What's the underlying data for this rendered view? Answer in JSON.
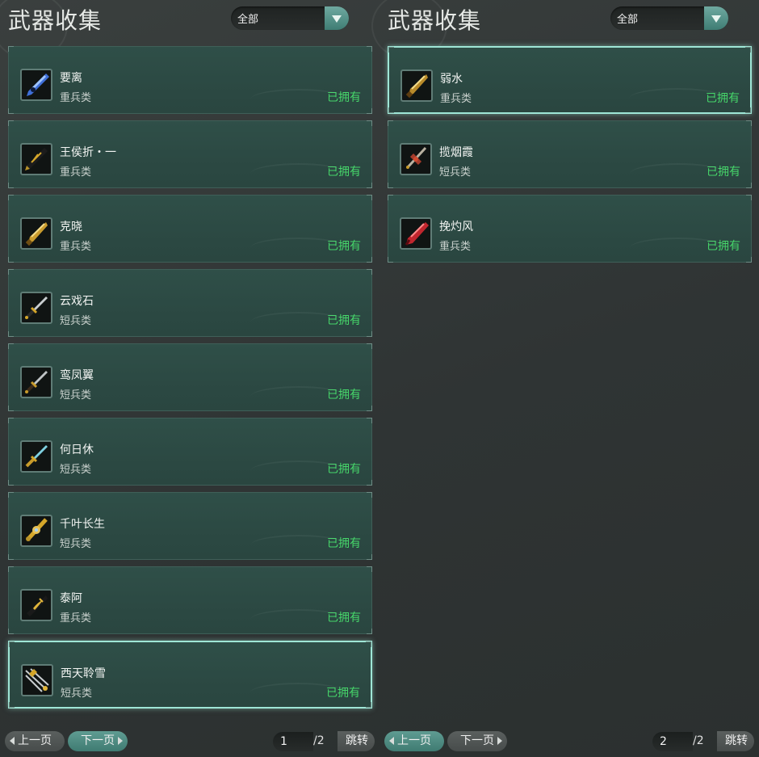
{
  "panels": [
    {
      "title": "武器收集",
      "filter": {
        "selected": "全部"
      },
      "items": [
        {
          "name": "要离",
          "category": "重兵类",
          "status": "已拥有",
          "icon": "blue-crystal-blade-icon"
        },
        {
          "name": "王侯折・一",
          "category": "重兵类",
          "status": "已拥有",
          "icon": "black-gold-sword-icon"
        },
        {
          "name": "克晓",
          "category": "重兵类",
          "status": "已拥有",
          "icon": "golden-blade-icon"
        },
        {
          "name": "云戏石",
          "category": "短兵类",
          "status": "已拥有",
          "icon": "dagger-icon"
        },
        {
          "name": "鸾凤翼",
          "category": "短兵类",
          "status": "已拥有",
          "icon": "dagger-icon"
        },
        {
          "name": "何日休",
          "category": "短兵类",
          "status": "已拥有",
          "icon": "jade-dagger-icon"
        },
        {
          "name": "千叶长生",
          "category": "短兵类",
          "status": "已拥有",
          "icon": "ornate-dagger-icon"
        },
        {
          "name": "泰阿",
          "category": "重兵类",
          "status": "已拥有",
          "icon": "black-gold-sword-icon"
        },
        {
          "name": "西天聆雪",
          "category": "短兵类",
          "status": "已拥有",
          "icon": "trident-dagger-icon"
        }
      ],
      "pagination": {
        "prev": "上一页",
        "next": "下一页",
        "page": "1",
        "total": "/2",
        "jump": "跳转"
      }
    },
    {
      "title": "武器收集",
      "filter": {
        "selected": "全部"
      },
      "items": [
        {
          "name": "弱水",
          "category": "重兵类",
          "status": "已拥有",
          "icon": "golden-blade-icon"
        },
        {
          "name": "揽烟霞",
          "category": "短兵类",
          "status": "已拥有",
          "icon": "red-ornate-dagger-icon"
        },
        {
          "name": "挽灼风",
          "category": "重兵类",
          "status": "已拥有",
          "icon": "red-crystal-blade-icon"
        }
      ],
      "pagination": {
        "prev": "上一页",
        "next": "下一页",
        "page": "2",
        "total": "/2",
        "jump": "跳转"
      }
    }
  ],
  "colors": {
    "owned": "#46d66a",
    "accent": "#4f8d83",
    "card": "#2e4d46"
  }
}
